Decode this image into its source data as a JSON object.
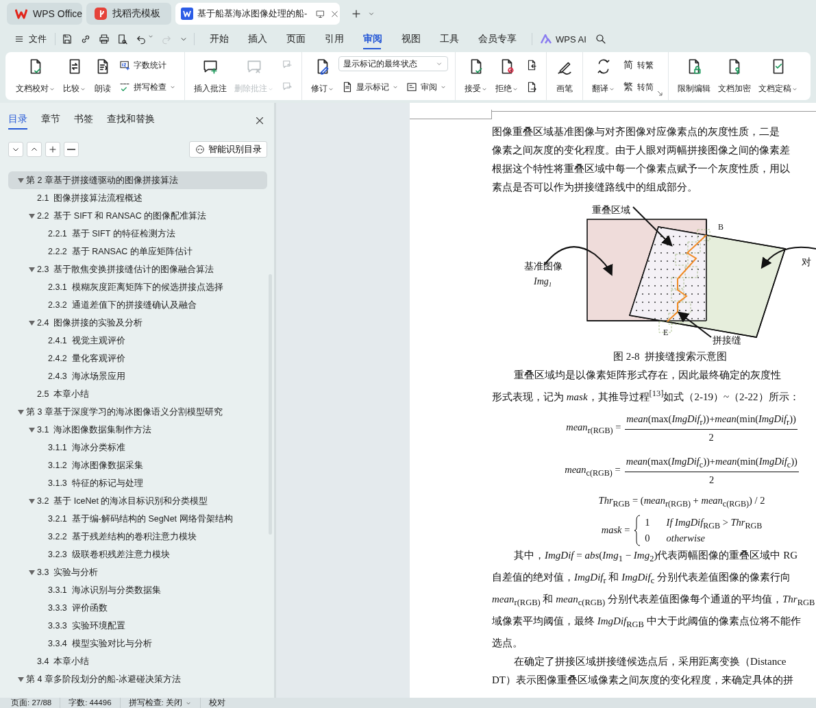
{
  "title_bar": {
    "tabs": [
      {
        "kind": "home",
        "label": "WPS Office",
        "selected": false
      },
      {
        "kind": "template",
        "label": "找稻壳模板",
        "selected": false
      },
      {
        "kind": "document",
        "label": "基于船基海冰图像处理的船-",
        "selected": true
      }
    ]
  },
  "menu_bar": {
    "file_label": "文件",
    "quick_access": [
      {
        "disabled": false
      },
      {
        "disabled": false
      },
      {
        "disabled": false
      },
      {
        "disabled": false
      },
      {
        "disabled": false
      },
      {
        "disabled": true
      }
    ],
    "tabs": [
      {
        "label": "开始",
        "selected": false
      },
      {
        "label": "插入",
        "selected": false
      },
      {
        "label": "页面",
        "selected": false
      },
      {
        "label": "引用",
        "selected": false
      },
      {
        "label": "审阅",
        "selected": true
      },
      {
        "label": "视图",
        "selected": false
      },
      {
        "label": "工具",
        "selected": false
      },
      {
        "label": "会员专享",
        "selected": false
      }
    ],
    "ai_label": "WPS AI"
  },
  "ribbon": {
    "groups": [
      {
        "columns": [
          [
            [
              {
                "kind": "large",
                "label": "文档校对",
                "dropdown": true,
                "disabled": false
              }
            ]
          ],
          [
            [
              {
                "kind": "large",
                "label": "比较",
                "dropdown": true,
                "disabled": false
              }
            ]
          ],
          [
            [
              {
                "kind": "large",
                "label": "朗读",
                "dropdown": false,
                "disabled": false
              }
            ]
          ],
          [
            [
              {
                "kind": "small",
                "label": "字数统计",
                "dropdown": false,
                "disabled": false
              }
            ],
            [
              {
                "kind": "small",
                "label": "拼写检查",
                "dropdown": true,
                "disabled": false
              }
            ]
          ]
        ]
      },
      {
        "columns": [
          [
            [
              {
                "kind": "large",
                "label": "插入批注",
                "dropdown": false,
                "disabled": false
              }
            ]
          ],
          [
            [
              {
                "kind": "large",
                "label": "删除批注",
                "dropdown": true,
                "disabled": true
              }
            ]
          ],
          [
            [
              {
                "kind": "small",
                "dropdown": false,
                "disabled": true
              }
            ],
            [
              {
                "kind": "small",
                "dropdown": false,
                "disabled": true
              }
            ]
          ]
        ]
      },
      {
        "columns": [
          [
            [
              {
                "kind": "large",
                "label": "修订",
                "dropdown": true,
                "disabled": false
              }
            ]
          ],
          [
            [
              {
                "kind": "select",
                "value": "显示标记的最终状态",
                "disabled": false
              }
            ],
            [
              {
                "kind": "small",
                "label": "显示标记",
                "dropdown": true,
                "disabled": false
              },
              {
                "kind": "small",
                "label": "审阅",
                "dropdown": true,
                "disabled": false
              }
            ]
          ]
        ]
      },
      {
        "columns": [
          [
            [
              {
                "kind": "large",
                "label": "接受",
                "dropdown": true,
                "disabled": false
              }
            ]
          ],
          [
            [
              {
                "kind": "large",
                "label": "拒绝",
                "dropdown": true,
                "disabled": false
              }
            ]
          ],
          [
            [
              {
                "kind": "small",
                "dropdown": false,
                "disabled": false
              }
            ],
            [
              {
                "kind": "small",
                "dropdown": false,
                "disabled": false
              }
            ]
          ]
        ]
      },
      {
        "columns": [
          [
            [
              {
                "kind": "large",
                "label": "画笔",
                "dropdown": false,
                "disabled": false
              }
            ]
          ]
        ]
      },
      {
        "columns": [
          [
            [
              {
                "kind": "large",
                "label": "翻译",
                "dropdown": true,
                "disabled": false
              }
            ]
          ],
          [
            [
              {
                "kind": "small",
                "glyph": "简",
                "label": "转繁",
                "dropdown": false,
                "disabled": false
              }
            ],
            [
              {
                "kind": "small",
                "glyph": "繁",
                "label": "转简",
                "dropdown": false,
                "disabled": false
              }
            ]
          ]
        ]
      },
      {
        "columns": [
          [
            [
              {
                "kind": "large",
                "label": "限制编辑",
                "dropdown": false,
                "disabled": false
              }
            ]
          ],
          [
            [
              {
                "kind": "large",
                "label": "文档加密",
                "dropdown": false,
                "disabled": false
              }
            ]
          ],
          [
            [
              {
                "kind": "large",
                "label": "文档定稿",
                "dropdown": true,
                "disabled": false
              }
            ]
          ]
        ]
      }
    ]
  },
  "side_panel": {
    "tabs": [
      {
        "label": "目录",
        "selected": true
      },
      {
        "label": "章节",
        "selected": false
      },
      {
        "label": "书签",
        "selected": false
      },
      {
        "label": "查找和替换",
        "selected": false
      }
    ],
    "smart_button": "智能识别目录",
    "toc": [
      {
        "label": "第 2 章基于拼接缝驱动的图像拼接算法",
        "selected": true,
        "expanded": true,
        "children": [
          {
            "label": "2.1  图像拼接算法流程概述",
            "selected": false
          },
          {
            "label": "2.2  基于 SIFT 和 RANSAC 的图像配准算法",
            "selected": false,
            "expanded": true,
            "children": [
              {
                "label": "2.2.1  基于 SIFT 的特征检测方法",
                "selected": false
              },
              {
                "label": "2.2.2  基于 RANSAC 的单应矩阵估计",
                "selected": false
              }
            ]
          },
          {
            "label": "2.3  基于散焦变换拼接缝估计的图像融合算法",
            "selected": false,
            "expanded": true,
            "children": [
              {
                "label": "2.3.1  模糊灰度距离矩阵下的候选拼接点选择",
                "selected": false
              },
              {
                "label": "2.3.2  通道差值下的拼接缝确认及融合",
                "selected": false
              }
            ]
          },
          {
            "label": "2.4  图像拼接的实验及分析",
            "selected": false,
            "expanded": true,
            "children": [
              {
                "label": "2.4.1  视觉主观评价",
                "selected": false
              },
              {
                "label": "2.4.2  量化客观评价",
                "selected": false
              },
              {
                "label": "2.4.3  海冰场景应用",
                "selected": false
              }
            ]
          },
          {
            "label": "2.5  本章小结",
            "selected": false
          }
        ]
      },
      {
        "label": "第 3 章基于深度学习的海冰图像语义分割模型研究",
        "selected": false,
        "expanded": true,
        "children": [
          {
            "label": "3.1  海冰图像数据集制作方法",
            "selected": false,
            "expanded": true,
            "children": [
              {
                "label": "3.1.1  海冰分类标准",
                "selected": false
              },
              {
                "label": "3.1.2  海冰图像数据采集",
                "selected": false
              },
              {
                "label": "3.1.3  特征的标记与处理",
                "selected": false
              }
            ]
          },
          {
            "label": "3.2  基于 IceNet 的海冰目标识别和分类模型",
            "selected": false,
            "expanded": true,
            "children": [
              {
                "label": "3.2.1  基于编-解码结构的 SegNet 网络骨架结构",
                "selected": false
              },
              {
                "label": "3.2.2  基于残差结构的卷积注意力模块",
                "selected": false
              },
              {
                "label": "3.2.3  级联卷积残差注意力模块",
                "selected": false
              }
            ]
          },
          {
            "label": "3.3  实验与分析",
            "selected": false,
            "expanded": true,
            "children": [
              {
                "label": "3.3.1  海冰识别与分类数据集",
                "selected": false
              },
              {
                "label": "3.3.3  评价函数",
                "selected": false
              },
              {
                "label": "3.3.3  实验环境配置",
                "selected": false
              },
              {
                "label": "3.3.4  模型实验对比与分析",
                "selected": false
              }
            ]
          },
          {
            "label": "3.4  本章小结",
            "selected": false
          }
        ]
      },
      {
        "label": "第 4 章多阶段划分的船-冰避碰决策方法",
        "selected": false,
        "expanded": true
      }
    ]
  },
  "document": {
    "blocks": [
      {
        "kind": "paragraph",
        "indent": false,
        "lines": [
          "图像重叠区域基准图像与对齐图像对应像素点的灰度性质，二是",
          "像素之间灰度的变化程度。由于人眼对两幅拼接图像之间的像素差",
          "根据这个特性将重叠区域中每一个像素点赋予一个灰度性质，用以",
          "素点是否可以作为拼接缝路线中的组成部分。"
        ]
      },
      {
        "kind": "figure",
        "labels": [
          "重叠区域",
          "B",
          "基准图像",
          "Img$_{1}$",
          "E",
          "拼接缝",
          "对"
        ]
      },
      {
        "kind": "caption",
        "text": "图 2-8  拼接缝搜索示意图"
      },
      {
        "kind": "paragraph",
        "indent": true,
        "lines": [
          "重叠区域均是以像素矩阵形式存在，因此最终确定的灰度性",
          "形式表现，记为 *mask*，其推导过程$^{[13]}$如式（2-19）~（2-22）所示："
        ]
      },
      {
        "kind": "fraction",
        "lhs": "*mean*$_{r(RGB)}$ =",
        "numerator": "*mean*(max(*ImgDif*$_{r}$))+*mean*(min(*ImgDif*$_{r}$))",
        "denominator": "2"
      },
      {
        "kind": "fraction",
        "lhs": "*mean*$_{c(RGB)}$ =",
        "numerator": "*mean*(max(*ImgDif*$_{c}$))+*mean*(min(*ImgDif*$_{c}$))",
        "denominator": "2"
      },
      {
        "kind": "equation",
        "text": "*Thr*$_{RGB}$ = (*mean*$_{r(RGB)}$ + *mean*$_{c(RGB)}$) / 2"
      },
      {
        "kind": "cases",
        "lhs": "*mask* =",
        "cases": [
          "1",
          "0"
        ],
        "conditions": [
          "*If ImgDif*$_{RGB}$ > *Thr*$_{RGB}$",
          "*otherwise*"
        ]
      },
      {
        "kind": "paragraph",
        "indent": true,
        "lines": [
          "其中，*ImgDif* = *abs*(*Img*$_{1}$ − *Img*$_{2}$)代表两幅图像的重叠区域中 RG",
          "自差值的绝对值，*ImgDif*$_{r}$ 和 *ImgDif*$_{c}$ 分别代表差值图像的像素行向",
          "*mean*$_{r(RGB)}$ 和 *mean*$_{c(RGB)}$ 分别代表差值图像每个通道的平均值，*Thr*$_{RGB}$",
          "域像素平均阈值，最终 *ImgDif*$_{RGB}$ 中大于此阈值的像素点位将不能作",
          "选点。"
        ]
      },
      {
        "kind": "paragraph",
        "indent": true,
        "lines": [
          "在确定了拼接区域拼接缝候选点后，采用距离变换（Distance",
          "DT）表示图像重叠区域像素之间灰度的变化程度，来确定具体的拼"
        ]
      }
    ]
  },
  "status_bar": {
    "items": [
      {
        "label": "页面: 27/88",
        "dropdown": false
      },
      {
        "label": "字数: 44496",
        "dropdown": false
      },
      {
        "label": "拼写检查: 关闭",
        "dropdown": true
      },
      {
        "label": "校对",
        "dropdown": false
      }
    ]
  }
}
